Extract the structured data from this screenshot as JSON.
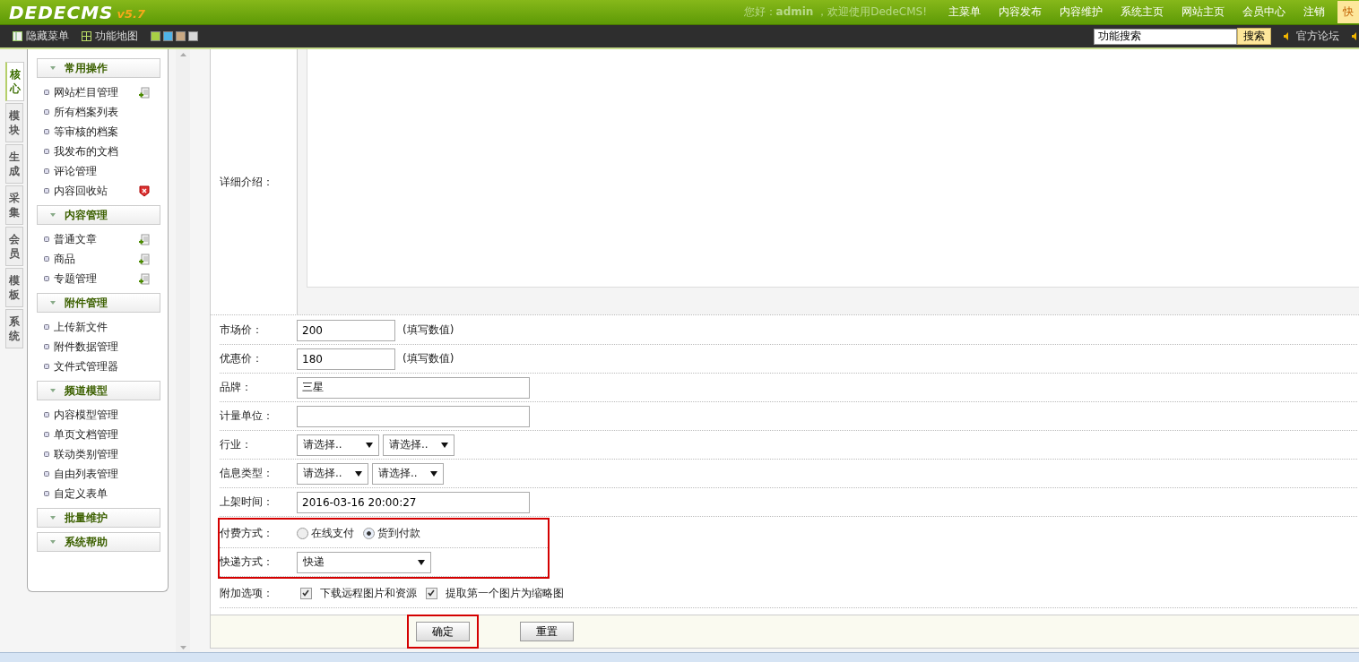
{
  "header": {
    "logo": "DEDECMS",
    "version": "v5.7",
    "greeting": "您好：**admin** ，欢迎使用DedeCMS!",
    "nav": [
      {
        "label": "主菜单",
        "kind": "link"
      },
      {
        "label": "内容发布",
        "kind": "link"
      },
      {
        "label": "内容维护",
        "kind": "link"
      },
      {
        "label": "系统主页",
        "kind": "link"
      },
      {
        "label": "网站主页",
        "kind": "link"
      },
      {
        "label": "会员中心",
        "kind": "link"
      },
      {
        "label": "注销",
        "kind": "link"
      },
      {
        "label": "快",
        "kind": "highlight"
      }
    ]
  },
  "toolbar": {
    "items": [
      {
        "label": "隐藏菜单",
        "kind": "columns"
      },
      {
        "label": "功能地图",
        "kind": "grid"
      }
    ],
    "skins": [
      {
        "color": "#a8cf45"
      },
      {
        "color": "#4fb3e8"
      },
      {
        "color": "#c9a882"
      },
      {
        "color": "#d8d8d8"
      }
    ],
    "search": {
      "value": "功能搜索",
      "button": "搜索"
    },
    "link": "官方论坛"
  },
  "side_tabs": [
    {
      "label": "核心",
      "selected": true
    },
    {
      "label": "模块",
      "selected": false
    },
    {
      "label": "生成",
      "selected": false
    },
    {
      "label": "采集",
      "selected": false
    },
    {
      "label": "会员",
      "selected": false
    },
    {
      "label": "模板",
      "selected": false
    },
    {
      "label": "系统",
      "selected": false
    }
  ],
  "menu": [
    {
      "title": "常用操作",
      "items": [
        {
          "label": "网站栏目管理",
          "kind": "add"
        },
        {
          "label": "所有档案列表",
          "kind": "plain"
        },
        {
          "label": "等审核的档案",
          "kind": "plain"
        },
        {
          "label": "我发布的文档",
          "kind": "plain"
        },
        {
          "label": "评论管理",
          "kind": "plain"
        },
        {
          "label": "内容回收站",
          "kind": "trash"
        }
      ]
    },
    {
      "title": "内容管理",
      "items": [
        {
          "label": "普通文章",
          "kind": "add"
        },
        {
          "label": "商品",
          "kind": "add"
        },
        {
          "label": "专题管理",
          "kind": "add"
        }
      ]
    },
    {
      "title": "附件管理",
      "items": [
        {
          "label": "上传新文件",
          "kind": "plain"
        },
        {
          "label": "附件数据管理",
          "kind": "plain"
        },
        {
          "label": "文件式管理器",
          "kind": "plain"
        }
      ]
    },
    {
      "title": "频道模型",
      "items": [
        {
          "label": "内容模型管理",
          "kind": "plain"
        },
        {
          "label": "单页文档管理",
          "kind": "plain"
        },
        {
          "label": "联动类别管理",
          "kind": "plain"
        },
        {
          "label": "自由列表管理",
          "kind": "plain"
        },
        {
          "label": "自定义表单",
          "kind": "plain"
        }
      ]
    },
    {
      "title": "批量维护"
    },
    {
      "title": "系统帮助"
    }
  ],
  "form": {
    "editor_label": "详细介绍：",
    "sections": [
      {
        "highlighted": false,
        "rows": [
          {
            "label": "市场价：",
            "kind": "number",
            "value": "200",
            "hint": "(填写数值)"
          },
          {
            "label": "优惠价：",
            "kind": "number",
            "value": "180",
            "hint": "(填写数值)"
          },
          {
            "label": "品牌：",
            "kind": "text",
            "value": "三星"
          },
          {
            "label": "计量单位：",
            "kind": "text"
          },
          {
            "label": "行业：",
            "kind": "selects",
            "options": [
              "请选择..",
              "请选择.."
            ]
          },
          {
            "label": "信息类型：",
            "kind": "selects",
            "options": [
              "请选择..",
              "请选择.."
            ]
          },
          {
            "label": "上架时间：",
            "kind": "text",
            "value": "2016-03-16 20:00:27"
          }
        ]
      },
      {
        "highlighted": true,
        "rows": [
          {
            "label": "付费方式：",
            "kind": "radio",
            "choices": [
              {
                "label": "在线支付",
                "selected": false
              },
              {
                "label": "货到付款",
                "selected": true
              }
            ]
          },
          {
            "label": "快递方式：",
            "kind": "select",
            "value": "快递"
          }
        ]
      },
      {
        "highlighted": false,
        "rows": [
          {
            "label": "附加选项：",
            "kind": "checks",
            "choices": [
              {
                "label": "下载远程图片和资源",
                "checked": true
              },
              {
                "label": "提取第一个图片为缩略图",
                "checked": true
              }
            ]
          }
        ]
      }
    ],
    "buttons": [
      {
        "label": "确定",
        "highlighted": true
      },
      {
        "label": "重置",
        "highlighted": false
      }
    ]
  }
}
